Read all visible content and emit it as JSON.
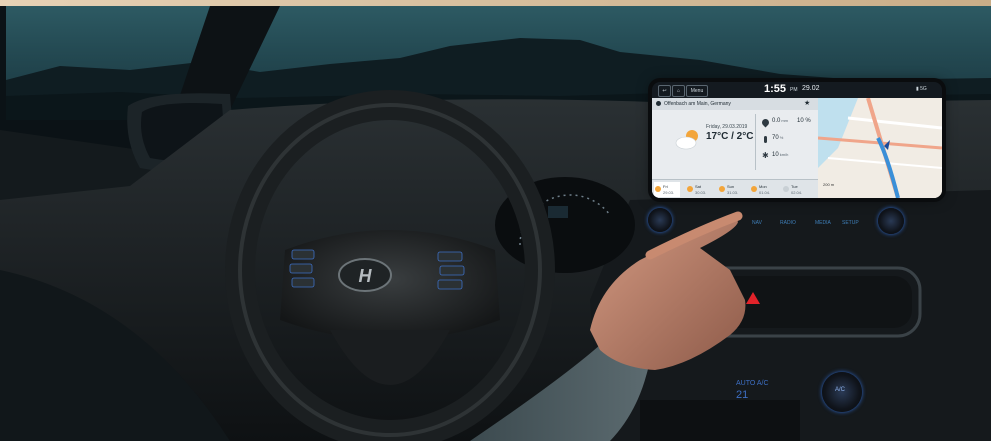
{
  "screen": {
    "status": {
      "back_icon": "back-arrow-icon",
      "home_icon": "home-icon",
      "menu_label": "Menu",
      "time": "1:55",
      "time_suffix": "PM",
      "date": "29.02",
      "signal_icon": "signal-icon"
    },
    "weather": {
      "location": "Offenbach am Main, Germany",
      "favorite_icon": "star-icon",
      "day": "Friday, 29.03.2019",
      "temperatures": "17°C / 2°C",
      "condition_icon": "partly-cloudy-icon",
      "stats": [
        {
          "value": "0.0",
          "unit": "mm",
          "extra": "10 %",
          "icon": "drop-icon"
        },
        {
          "value": "70",
          "unit": "%",
          "extra": "",
          "icon": "thermometer-icon"
        },
        {
          "value": "10",
          "unit": "km/h",
          "extra": "",
          "icon": "wind-icon"
        }
      ],
      "forecast": [
        {
          "label": "Fri",
          "sub": "29.03."
        },
        {
          "label": "Sat",
          "sub": "30.03."
        },
        {
          "label": "Sun",
          "sub": "31.03."
        },
        {
          "label": "Mon",
          "sub": "01.04."
        },
        {
          "label": "Tue",
          "sub": "02.04."
        }
      ]
    },
    "map": {
      "scale": "200 m",
      "position_icon": "navigation-arrow-icon"
    }
  },
  "hardware_buttons": [
    "NAV",
    "RADIO",
    "MEDIA",
    "SETUP"
  ],
  "climate": {
    "label": "AUTO A/C",
    "temp": "21",
    "button": "A/C"
  },
  "colors": {
    "sky": "#2d5a63",
    "screen_ui": "#e9ecef",
    "accent_blue": "#3f7fb9",
    "hazard_red": "#e2232a"
  }
}
